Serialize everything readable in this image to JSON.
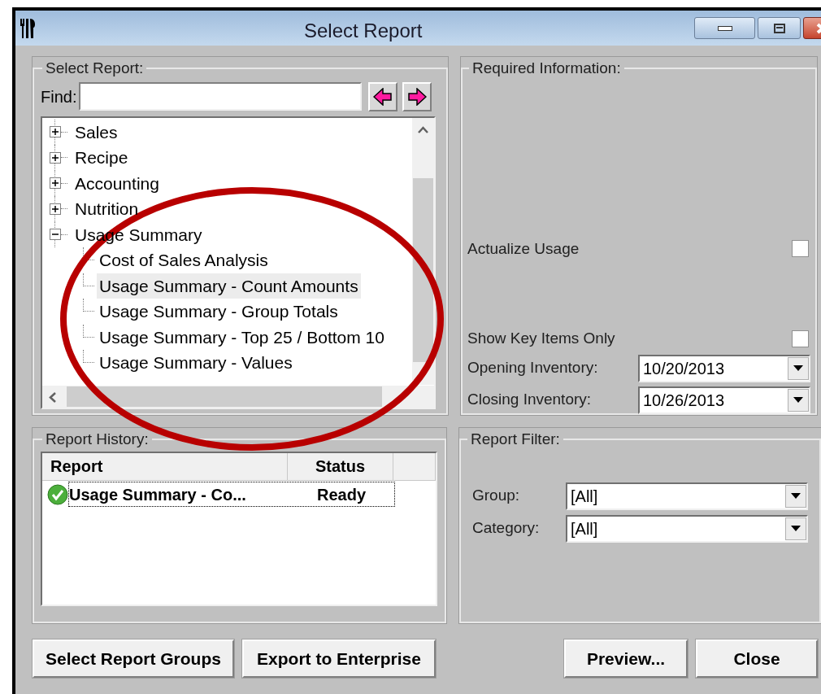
{
  "window": {
    "title": "Select Report"
  },
  "select_report": {
    "legend": "Select Report:",
    "find": {
      "label": "Find:"
    },
    "tree": [
      {
        "label": "Sales",
        "expanded": false,
        "selected": false
      },
      {
        "label": "Recipe",
        "expanded": false,
        "selected": false
      },
      {
        "label": "Accounting",
        "expanded": false,
        "selected": false
      },
      {
        "label": "Nutrition",
        "expanded": false,
        "selected": false
      },
      {
        "label": "Usage Summary",
        "expanded": true,
        "selected": false,
        "children": [
          {
            "label": "Cost of Sales Analysis",
            "selected": false
          },
          {
            "label": "Usage Summary - Count Amounts",
            "selected": true
          },
          {
            "label": "Usage Summary - Group Totals",
            "selected": false
          },
          {
            "label": "Usage Summary - Top 25 / Bottom 10",
            "selected": false
          },
          {
            "label": "Usage Summary - Values",
            "selected": false
          }
        ]
      }
    ]
  },
  "required_information": {
    "legend": "Required Information:",
    "fields": [
      {
        "kind": "checkbox",
        "label": "Actualize Usage",
        "checked": false
      },
      {
        "kind": "checkbox",
        "label": "Show Key Items Only",
        "checked": false
      },
      {
        "kind": "dropdown",
        "label": "Opening Inventory:",
        "value": "10/20/2013"
      },
      {
        "kind": "dropdown",
        "label": "Closing Inventory:",
        "value": "10/26/2013"
      }
    ]
  },
  "report_history": {
    "legend": "Report History:",
    "columns": [
      "Report",
      "Status"
    ],
    "rows": [
      {
        "report": "Usage Summary - Co...",
        "status": "Ready",
        "selected": true
      }
    ]
  },
  "report_filter": {
    "legend": "Report Filter:",
    "fields": [
      {
        "label": "Group:",
        "value": "[All]"
      },
      {
        "label": "Category:",
        "value": "[All]"
      }
    ]
  },
  "left_buttons": [
    {
      "label": "Select Report Groups"
    },
    {
      "label": "Export to Enterprise"
    }
  ],
  "right_buttons": [
    {
      "label": "Preview..."
    },
    {
      "label": "Close"
    }
  ],
  "annotation": {
    "kind": "ellipse"
  }
}
